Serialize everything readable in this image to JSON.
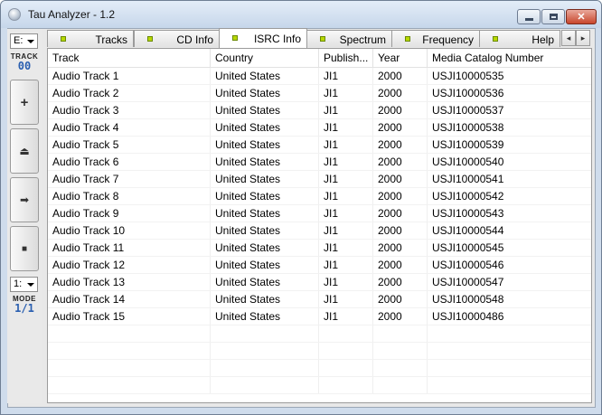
{
  "window": {
    "title": "Tau Analyzer - 1.2",
    "close_glyph": "✕"
  },
  "strip": {
    "drive_value": "E:",
    "track_label": "TRACK",
    "track_value": "00",
    "buttons": [
      {
        "name": "add-button",
        "icon": "plus-icon",
        "glyph": "+"
      },
      {
        "name": "eject-button",
        "icon": "eject-icon",
        "glyph": "⏏"
      },
      {
        "name": "play-button",
        "icon": "arrow-right-icon",
        "glyph": "➡"
      },
      {
        "name": "stop-button",
        "icon": "stop-icon",
        "glyph": "■"
      }
    ],
    "mode_select_value": "1:",
    "mode_label": "MODE",
    "mode_value": "1/1"
  },
  "tabs": [
    {
      "label": "Tracks",
      "active": false
    },
    {
      "label": "CD Info",
      "active": false
    },
    {
      "label": "ISRC Info",
      "active": true
    },
    {
      "label": "Spectrum",
      "active": false
    },
    {
      "label": "Frequency",
      "active": false
    },
    {
      "label": "Help",
      "active": false
    }
  ],
  "tab_scroll": {
    "left": "◂",
    "right": "▸"
  },
  "grid": {
    "columns": [
      "Track",
      "Country",
      "Publish...",
      "Year",
      "Media Catalog Number"
    ],
    "rows": [
      [
        "Audio Track 1",
        "United States",
        "JI1",
        "2000",
        "USJI10000535"
      ],
      [
        "Audio Track 2",
        "United States",
        "JI1",
        "2000",
        "USJI10000536"
      ],
      [
        "Audio Track 3",
        "United States",
        "JI1",
        "2000",
        "USJI10000537"
      ],
      [
        "Audio Track 4",
        "United States",
        "JI1",
        "2000",
        "USJI10000538"
      ],
      [
        "Audio Track 5",
        "United States",
        "JI1",
        "2000",
        "USJI10000539"
      ],
      [
        "Audio Track 6",
        "United States",
        "JI1",
        "2000",
        "USJI10000540"
      ],
      [
        "Audio Track 7",
        "United States",
        "JI1",
        "2000",
        "USJI10000541"
      ],
      [
        "Audio Track 8",
        "United States",
        "JI1",
        "2000",
        "USJI10000542"
      ],
      [
        "Audio Track 9",
        "United States",
        "JI1",
        "2000",
        "USJI10000543"
      ],
      [
        "Audio Track 10",
        "United States",
        "JI1",
        "2000",
        "USJI10000544"
      ],
      [
        "Audio Track 11",
        "United States",
        "JI1",
        "2000",
        "USJI10000545"
      ],
      [
        "Audio Track 12",
        "United States",
        "JI1",
        "2000",
        "USJI10000546"
      ],
      [
        "Audio Track 13",
        "United States",
        "JI1",
        "2000",
        "USJI10000547"
      ],
      [
        "Audio Track 14",
        "United States",
        "JI1",
        "2000",
        "USJI10000548"
      ],
      [
        "Audio Track 15",
        "United States",
        "JI1",
        "2000",
        "USJI10000486"
      ]
    ]
  },
  "colors": {
    "led": "#b8d800",
    "readout": "#2a5fb0",
    "close": "#c8462c"
  }
}
